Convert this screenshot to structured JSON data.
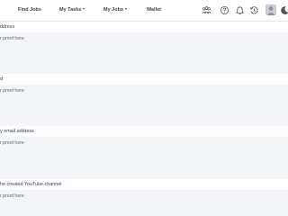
{
  "nav": {
    "find_jobs": "Find Jobs",
    "my_tasks": "My Tasks",
    "my_jobs": "My Jobs",
    "wallet": "Wallet"
  },
  "icons": {
    "team": "team-icon",
    "help": "help-icon",
    "notifications": "bell-icon",
    "history": "history-icon",
    "avatar": "avatar-icon",
    "theme": "moon-icon"
  },
  "sections": [
    {
      "label": "ddress",
      "placeholder": "r proof here"
    },
    {
      "label": "d",
      "placeholder": "r proof here"
    },
    {
      "label": "y email address",
      "placeholder": "r proof here"
    },
    {
      "label": "he created YouTube channel",
      "placeholder": "r proof here"
    }
  ],
  "colors": {
    "background": "#eef0f4",
    "proof_area": "#f3f5f9",
    "text": "#3a4250"
  }
}
